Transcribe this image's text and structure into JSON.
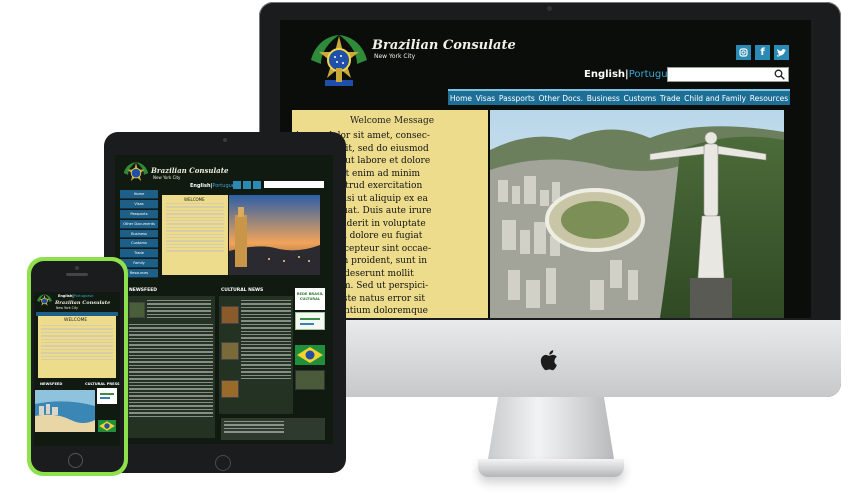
{
  "site": {
    "title": "Brazilian Consulate",
    "subtitle": "New York City"
  },
  "language": {
    "english": "English",
    "separator": "|",
    "portuguese": "Portuguese"
  },
  "social_icons": [
    "instagram-icon",
    "facebook-icon",
    "twitter-icon"
  ],
  "nav": {
    "items": [
      "Home",
      "Visas",
      "Passports",
      "Other Docs.",
      "Business",
      "Customs",
      "Trade",
      "Child and Family",
      "Resources"
    ]
  },
  "welcome": {
    "title": "Welcome Message",
    "lines": [
      "ipsum dolor sit amet, consec-",
      "ipisicing elit, sed do eiusmod",
      "incididunt ut labore et dolore",
      "a aliqua. Ut enim ad minim",
      "n, quis nostrud exercitation",
      "o laboris nisi ut aliquip ex ea",
      "do consequat. Duis aute irure",
      "n reprehenderit in voluptate",
      "esse cillum dolore eu fugiat",
      "ariatur. Excepteur sint occae-",
      "pidatat non proident, sunt in",
      "qui officia deserunt mollit",
      "est laborum. Sed ut perspici-",
      "de omnis iste natus error sit",
      "em accusantium doloremque"
    ]
  },
  "tablet": {
    "sidebar": [
      "Home",
      "Visas",
      "Passports",
      "Other Documents",
      "Business",
      "Customs",
      "Trade",
      "Family",
      "Resources"
    ],
    "welcome_title": "WELCOME",
    "newsfeed_label": "NEWSFEED",
    "cultural_label": "CULTURAL NEWS",
    "partner_label": "REDE BRASIL CULTURAL"
  },
  "phone": {
    "welcome_title": "WELCOME",
    "newsfeed_label": "NEWSFEED",
    "cultural_label": "CULTURAL PRESS"
  },
  "colors": {
    "nav_blue": "#1d6f96",
    "panel_yellow": "#eddc8b",
    "portuguese_link": "#39a6d6",
    "phone_body": "#8ee04d"
  }
}
